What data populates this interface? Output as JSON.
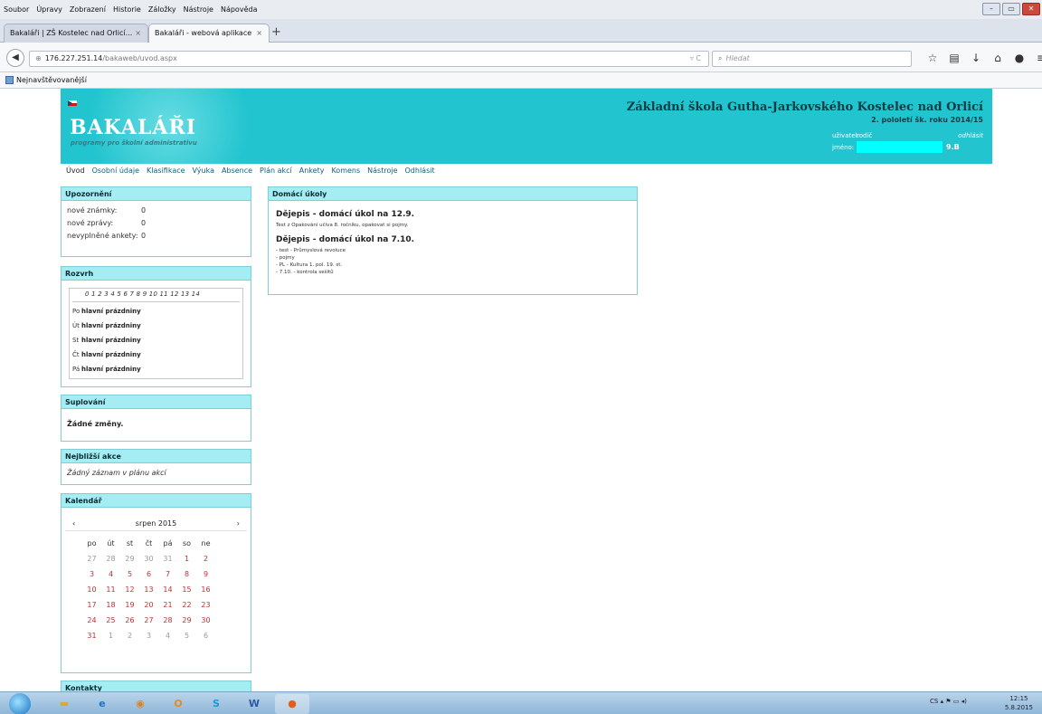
{
  "browser": {
    "menu": [
      "Soubor",
      "Úpravy",
      "Zobrazení",
      "Historie",
      "Záložky",
      "Nástroje",
      "Nápověda"
    ],
    "tabs": [
      {
        "label": "Bakaláři | ZŠ Kostelec nad Orlicí..."
      },
      {
        "label": "Bakaláři - webová aplikace"
      }
    ],
    "url_host": "176.227.251.14",
    "url_path": "/bakaweb/uvod.aspx",
    "search_placeholder": "Hledat",
    "bookmark": "Nejnavštěvovanější"
  },
  "header": {
    "logo": "BAKALÁŘI",
    "slogan": "programy pro školní administrativu",
    "school": "Základní škola Gutha-Jarkovského Kostelec nad Orlicí",
    "semester": "2. pololetí šk. roku 2014/15",
    "user_label": "uživatel:",
    "user_value": "rodič",
    "logout_small": "odhlásit",
    "name_label": "jméno:",
    "class_value": "9.B"
  },
  "nav": [
    "Úvod",
    "Osobní údaje",
    "Klasifikace",
    "Výuka",
    "Absence",
    "Plán akcí",
    "Ankety",
    "Komens",
    "Nástroje",
    "Odhlásit"
  ],
  "notices": {
    "title": "Upozornění",
    "rows": [
      {
        "k": "nové známky:",
        "v": "0"
      },
      {
        "k": "nové zprávy:",
        "v": "0"
      },
      {
        "k": "nevyplněné ankety:",
        "v": "0"
      }
    ]
  },
  "schedule": {
    "title": "Rozvrh",
    "hours": "0 1 2 3 4 5 6 7 8 9 10 11 12 13 14",
    "days": [
      {
        "d": "Po",
        "v": "hlavní prázdniny"
      },
      {
        "d": "Út",
        "v": "hlavní prázdniny"
      },
      {
        "d": "St",
        "v": "hlavní prázdniny"
      },
      {
        "d": "Čt",
        "v": "hlavní prázdniny"
      },
      {
        "d": "Pá",
        "v": "hlavní prázdniny"
      }
    ]
  },
  "substitutions": {
    "title": "Suplování",
    "text": "Žádné změny."
  },
  "events": {
    "title": "Nejbližší akce",
    "text": "Žádný záznam v plánu akcí"
  },
  "calendar": {
    "title": "Kalendář",
    "month": "srpen 2015",
    "prev": "‹",
    "next": "›",
    "weekdays": [
      "po",
      "út",
      "st",
      "čt",
      "pá",
      "so",
      "ne"
    ],
    "weeks": [
      [
        "27",
        "28",
        "29",
        "30",
        "31",
        "1",
        "2"
      ],
      [
        "3",
        "4",
        "5",
        "6",
        "7",
        "8",
        "9"
      ],
      [
        "10",
        "11",
        "12",
        "13",
        "14",
        "15",
        "16"
      ],
      [
        "17",
        "18",
        "19",
        "20",
        "21",
        "22",
        "23"
      ],
      [
        "24",
        "25",
        "26",
        "27",
        "28",
        "29",
        "30"
      ],
      [
        "31",
        "1",
        "2",
        "3",
        "4",
        "5",
        "6"
      ]
    ]
  },
  "contacts": {
    "title": "Kontakty"
  },
  "homework": {
    "title": "Domácí úkoly",
    "items": [
      {
        "title": "Dějepis - domácí úkol na 12.9.",
        "lines": [
          "Test z Opakování učiva 8. ročníku, opakovat si pojmy."
        ]
      },
      {
        "title": "Dějepis - domácí úkol na 7.10.",
        "lines": [
          "- test - Průmyslová revoluce",
          "- pojmy",
          "- PL - Kultura 1. pol. 19. st.",
          "- 7.10. - kontrola sešitů"
        ]
      }
    ]
  },
  "taskbar": {
    "lang": "CS",
    "time": "12:15",
    "date": "5.8.2015"
  },
  "colors": {
    "header": "#21c4cf",
    "box_header": "#a4eef3",
    "calendar_current": "#b33333",
    "highlight": "#00ffff"
  }
}
